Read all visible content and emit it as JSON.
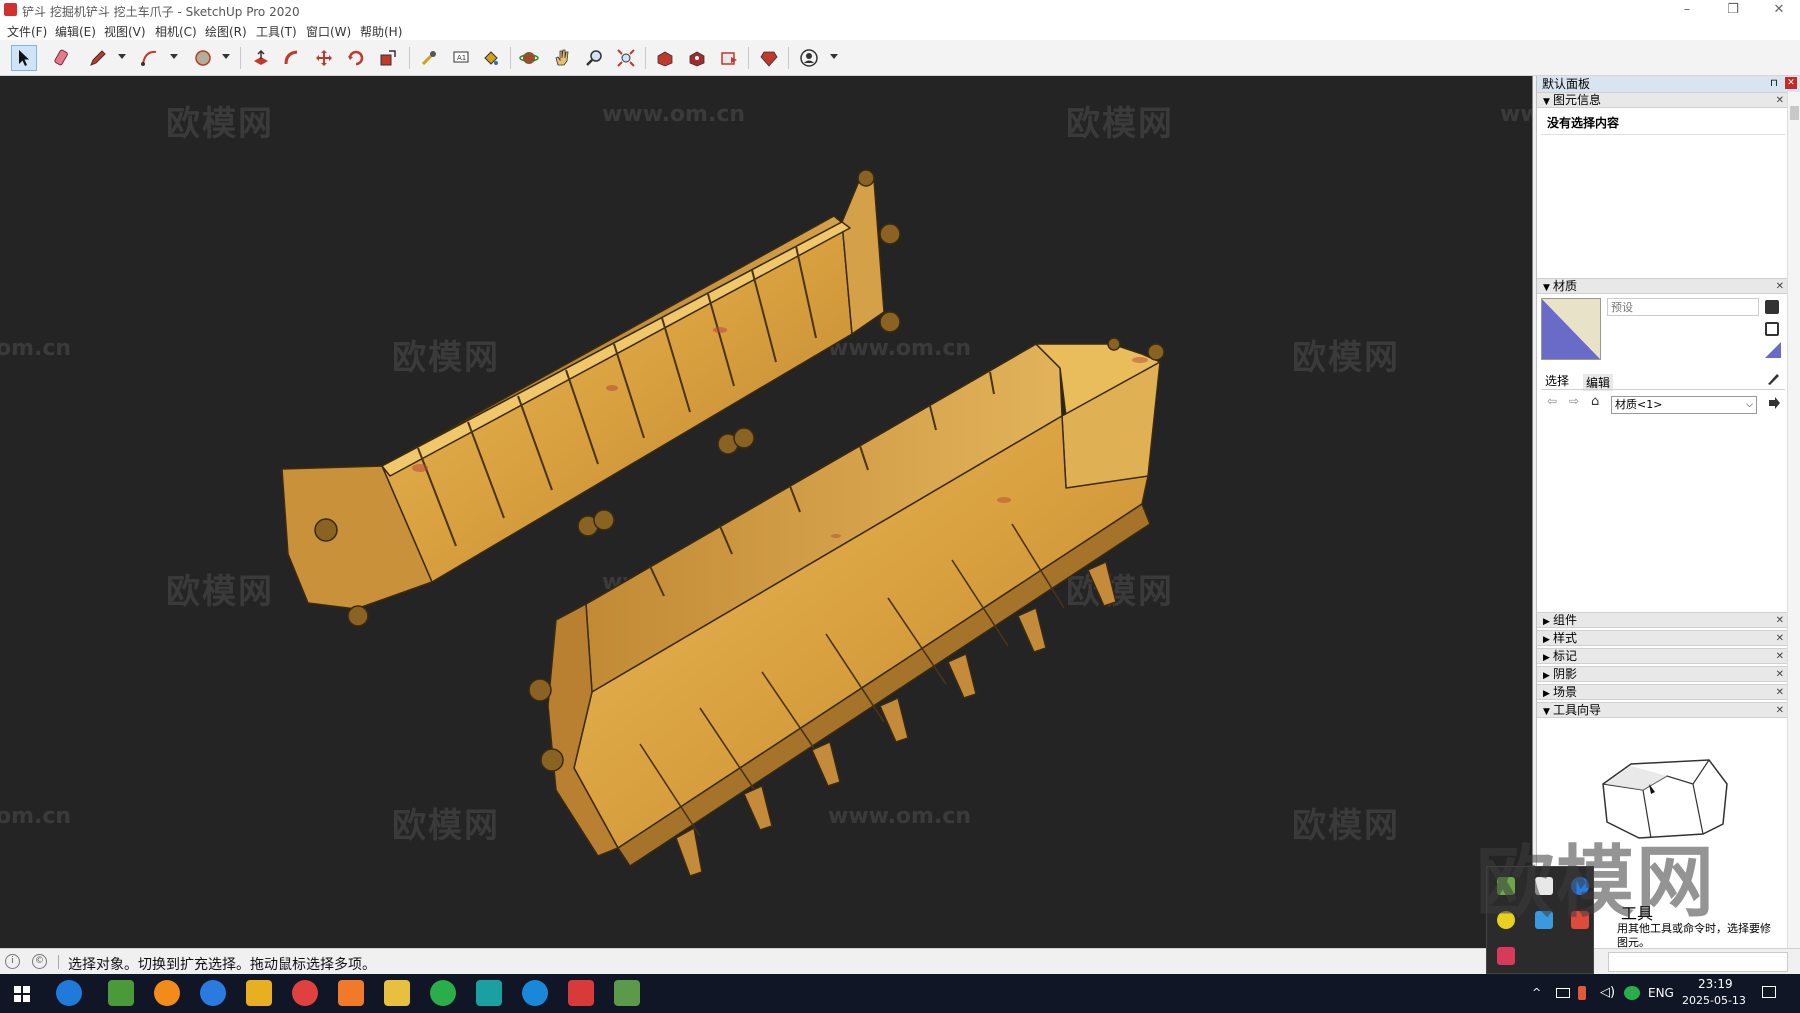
{
  "window": {
    "title": "铲斗 挖掘机铲斗 挖土车爪子 - SketchUp Pro 2020",
    "minimize": "–",
    "restore": "❐",
    "close": "✕"
  },
  "menu": [
    "文件(F)",
    "编辑(E)",
    "视图(V)",
    "相机(C)",
    "绘图(R)",
    "工具(T)",
    "窗口(W)",
    "帮助(H)"
  ],
  "toolbar": {
    "tools": [
      "select-icon",
      "eraser-icon",
      "pencil-icon",
      "arc-icon",
      "shape-icon",
      "push-pull-icon",
      "follow-me-icon",
      "move-icon",
      "rotate-icon",
      "scale-icon",
      "tape-measure-icon",
      "text-icon",
      "paint-bucket-icon",
      "orbit-icon",
      "pan-icon",
      "zoom-icon",
      "zoom-extents-icon",
      "warehouse-icon",
      "extension-warehouse-icon",
      "layout-icon",
      "ruby-icon",
      "account-icon"
    ]
  },
  "viewport": {
    "watermarks_cn": "欧模网",
    "watermarks_url": "www.om.cn",
    "watermark_partial": "om.cn"
  },
  "panel": {
    "title": "默认面板",
    "entity_info": {
      "header": "图元信息",
      "empty_text": "没有选择内容"
    },
    "materials": {
      "header": "材质",
      "name_placeholder": "预设",
      "tab_select": "选择",
      "tab_edit": "编辑",
      "collection": "材质<1>"
    },
    "collapsed_sections": [
      "组件",
      "样式",
      "标记",
      "阴影",
      "场景"
    ],
    "instructor": {
      "header": "工具向导",
      "title": "工具",
      "desc_1": "用其他工具或命令时，选择要修",
      "desc_2": "图元。"
    }
  },
  "status": {
    "text": "选择对象。切换到扩充选择。拖动鼠标选择多项。"
  },
  "taskbar": {
    "lang": "ENG",
    "time": "23:19",
    "date": "2025-05-13"
  },
  "big_watermark": "欧模网",
  "colors": {
    "viewport_bg": "#242424",
    "bucket_base": "#c9952f",
    "bucket_light": "#e7b95a",
    "bucket_dark": "#8a6221",
    "material_swatch_a": "#6a6ac8",
    "material_swatch_b": "#e8e2c8"
  }
}
